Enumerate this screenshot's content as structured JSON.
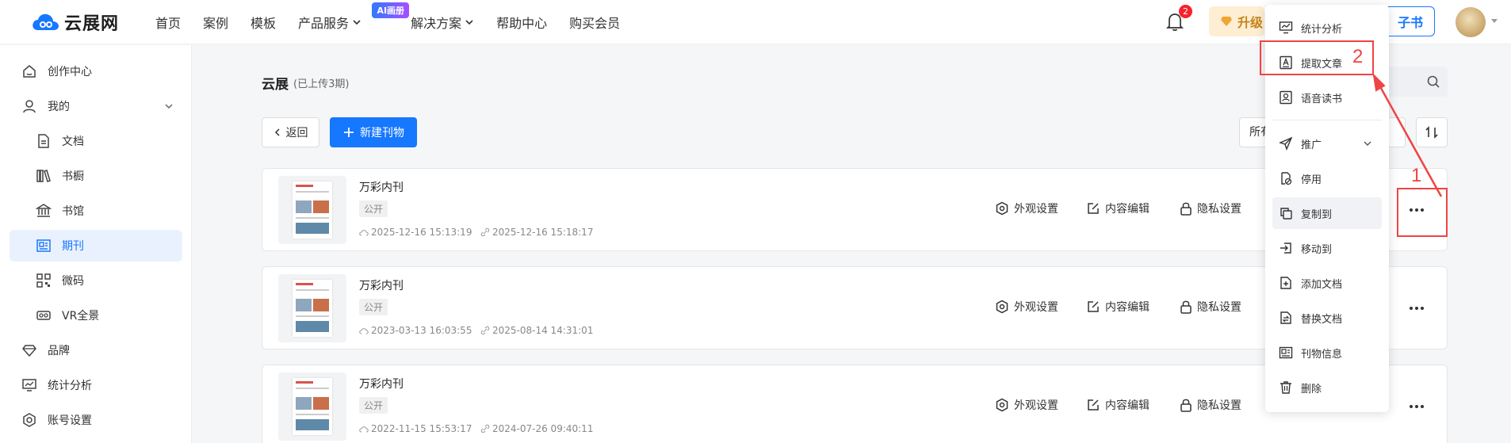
{
  "header": {
    "logo_text": "云展网",
    "nav": [
      {
        "label": "首页"
      },
      {
        "label": "案例"
      },
      {
        "label": "模板"
      },
      {
        "label": "产品服务"
      },
      {
        "label": "解决方案"
      },
      {
        "label": "帮助中心"
      },
      {
        "label": "购买会员"
      }
    ],
    "ai_badge": "AI画册",
    "notification_count": "2",
    "upgrade_label": "升级",
    "ebook_label": "子书"
  },
  "sidebar": {
    "items": [
      {
        "label": "创作中心",
        "icon": "home-icon"
      },
      {
        "label": "我的",
        "icon": "user-icon"
      },
      {
        "label": "文档",
        "icon": "document-icon"
      },
      {
        "label": "书橱",
        "icon": "bookshelf-icon"
      },
      {
        "label": "书馆",
        "icon": "library-icon"
      },
      {
        "label": "期刊",
        "icon": "periodical-icon"
      },
      {
        "label": "微码",
        "icon": "qrcode-icon"
      },
      {
        "label": "VR全景",
        "icon": "vr-icon"
      },
      {
        "label": "品牌",
        "icon": "diamond-icon"
      },
      {
        "label": "统计分析",
        "icon": "chart-icon"
      },
      {
        "label": "账号设置",
        "icon": "settings-icon"
      }
    ]
  },
  "main": {
    "title": "云展",
    "count": "(已上传3期)",
    "back_label": "返回",
    "new_label": "新建刊物",
    "filter_label": "所有",
    "actions": {
      "appearance": "外观设置",
      "content_edit": "内容编辑",
      "privacy": "隐私设置"
    },
    "cards": [
      {
        "name": "万彩内刊",
        "tag": "公开",
        "created": "2025-12-16 15:13:19",
        "updated": "2025-12-16 15:18:17"
      },
      {
        "name": "万彩内刊",
        "tag": "公开",
        "created": "2023-03-13 16:03:55",
        "updated": "2025-08-14 14:31:01"
      },
      {
        "name": "万彩内刊",
        "tag": "公开",
        "created": "2022-11-15 15:53:17",
        "updated": "2024-07-26 09:40:11"
      }
    ]
  },
  "menu": {
    "items": [
      {
        "label": "统计分析",
        "icon": "chart-icon"
      },
      {
        "label": "提取文章",
        "icon": "extract-article-icon"
      },
      {
        "label": "语音读书",
        "icon": "voice-book-icon"
      },
      {
        "label": "推广",
        "icon": "send-icon"
      },
      {
        "label": "停用",
        "icon": "disable-icon"
      },
      {
        "label": "复制到",
        "icon": "copy-icon"
      },
      {
        "label": "移动到",
        "icon": "move-icon"
      },
      {
        "label": "添加文档",
        "icon": "add-document-icon"
      },
      {
        "label": "替换文档",
        "icon": "replace-document-icon"
      },
      {
        "label": "刊物信息",
        "icon": "info-icon"
      },
      {
        "label": "删除",
        "icon": "delete-icon"
      }
    ]
  },
  "annotations": {
    "step1": "1",
    "step2": "2",
    "color": "#ef4444"
  },
  "colors": {
    "primary": "#1677ff",
    "active_bg": "#eaf1fe",
    "danger": "#ef4444"
  }
}
